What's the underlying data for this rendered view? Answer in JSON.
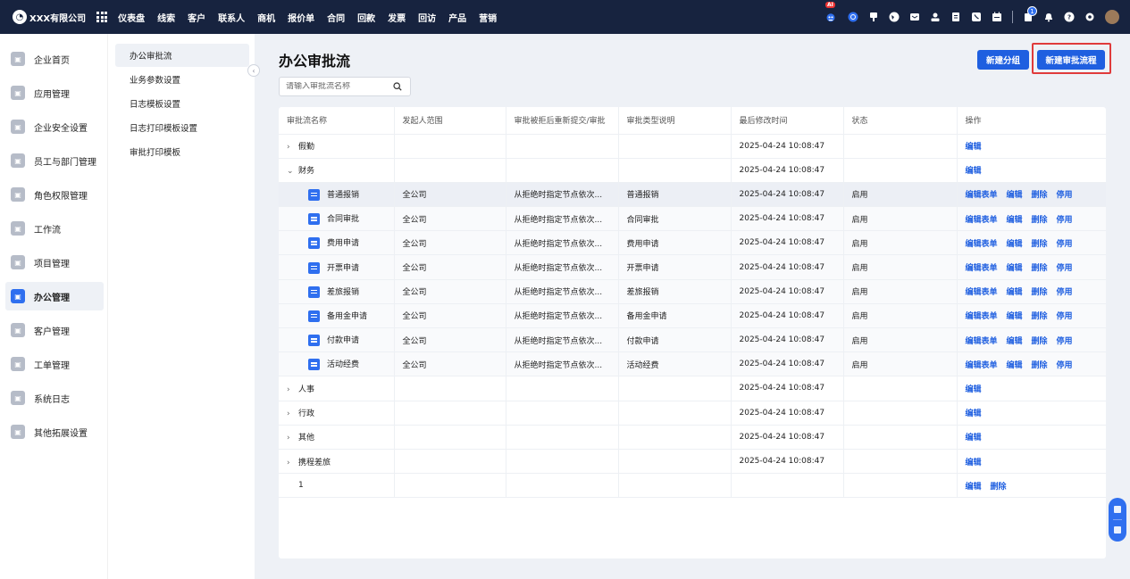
{
  "topbar": {
    "brand": "XXX有限公司",
    "nav": [
      "仪表盘",
      "线索",
      "客户",
      "联系人",
      "商机",
      "报价单",
      "合同",
      "回款",
      "发票",
      "回访",
      "产品",
      "营销"
    ],
    "ai_badge": "AI",
    "notification_count": "1",
    "icons": [
      "ai-robot-icon",
      "chat-icon",
      "pin-icon",
      "globe-icon",
      "mail-icon",
      "user-icon",
      "doc-icon",
      "phone-icon",
      "calendar-icon",
      "bell-icon",
      "help-icon",
      "settings-icon"
    ]
  },
  "sidebar": {
    "items": [
      {
        "label": "企业首页",
        "icon": "home-icon"
      },
      {
        "label": "应用管理",
        "icon": "apps-icon"
      },
      {
        "label": "企业安全设置",
        "icon": "shield-icon"
      },
      {
        "label": "员工与部门管理",
        "icon": "users-icon"
      },
      {
        "label": "角色权限管理",
        "icon": "role-icon"
      },
      {
        "label": "工作流",
        "icon": "workflow-icon"
      },
      {
        "label": "项目管理",
        "icon": "project-icon"
      },
      {
        "label": "办公管理",
        "icon": "office-icon",
        "active": true
      },
      {
        "label": "客户管理",
        "icon": "customer-icon"
      },
      {
        "label": "工单管理",
        "icon": "ticket-icon"
      },
      {
        "label": "系统日志",
        "icon": "log-icon"
      },
      {
        "label": "其他拓展设置",
        "icon": "extend-icon"
      }
    ]
  },
  "submenu": {
    "items": [
      "办公审批流",
      "业务参数设置",
      "日志模板设置",
      "日志打印模板设置",
      "审批打印模板"
    ],
    "active": 0
  },
  "main": {
    "title": "办公审批流",
    "search_placeholder": "请输入审批流名称",
    "btn_new_group": "新建分组",
    "btn_new_flow": "新建审批流程"
  },
  "table": {
    "headers": [
      "审批流名称",
      "发起人范围",
      "审批被拒后重新提交/审批",
      "审批类型说明",
      "最后修改时间",
      "状态",
      "操作"
    ],
    "rows": [
      {
        "name": "假勤",
        "type": "group",
        "expanded": false,
        "scope": "",
        "resubmit": "",
        "desc": "",
        "time": "2025-04-24 10:08:47",
        "status": "",
        "ops": [
          "编辑"
        ]
      },
      {
        "name": "财务",
        "type": "group",
        "expanded": true,
        "scope": "",
        "resubmit": "",
        "desc": "",
        "time": "2025-04-24 10:08:47",
        "status": "",
        "ops": [
          "编辑"
        ]
      },
      {
        "name": "普通报销",
        "type": "flow",
        "hl": true,
        "scope": "全公司",
        "resubmit": "从拒绝时指定节点依次...",
        "desc": "普通报销",
        "time": "2025-04-24 10:08:47",
        "status": "启用",
        "ops": [
          "编辑表单",
          "编辑",
          "删除",
          "停用"
        ]
      },
      {
        "name": "合同审批",
        "type": "flow",
        "scope": "全公司",
        "resubmit": "从拒绝时指定节点依次...",
        "desc": "合同审批",
        "time": "2025-04-24 10:08:47",
        "status": "启用",
        "ops": [
          "编辑表单",
          "编辑",
          "删除",
          "停用"
        ]
      },
      {
        "name": "费用申请",
        "type": "flow",
        "scope": "全公司",
        "resubmit": "从拒绝时指定节点依次...",
        "desc": "费用申请",
        "time": "2025-04-24 10:08:47",
        "status": "启用",
        "ops": [
          "编辑表单",
          "编辑",
          "删除",
          "停用"
        ]
      },
      {
        "name": "开票申请",
        "type": "flow",
        "scope": "全公司",
        "resubmit": "从拒绝时指定节点依次...",
        "desc": "开票申请",
        "time": "2025-04-24 10:08:47",
        "status": "启用",
        "ops": [
          "编辑表单",
          "编辑",
          "删除",
          "停用"
        ]
      },
      {
        "name": "差旅报销",
        "type": "flow",
        "scope": "全公司",
        "resubmit": "从拒绝时指定节点依次...",
        "desc": "差旅报销",
        "time": "2025-04-24 10:08:47",
        "status": "启用",
        "ops": [
          "编辑表单",
          "编辑",
          "删除",
          "停用"
        ]
      },
      {
        "name": "备用金申请",
        "type": "flow",
        "scope": "全公司",
        "resubmit": "从拒绝时指定节点依次...",
        "desc": "备用金申请",
        "time": "2025-04-24 10:08:47",
        "status": "启用",
        "ops": [
          "编辑表单",
          "编辑",
          "删除",
          "停用"
        ]
      },
      {
        "name": "付款申请",
        "type": "flow",
        "scope": "全公司",
        "resubmit": "从拒绝时指定节点依次...",
        "desc": "付款申请",
        "time": "2025-04-24 10:08:47",
        "status": "启用",
        "ops": [
          "编辑表单",
          "编辑",
          "删除",
          "停用"
        ]
      },
      {
        "name": "活动经费",
        "type": "flow",
        "scope": "全公司",
        "resubmit": "从拒绝时指定节点依次...",
        "desc": "活动经费",
        "time": "2025-04-24 10:08:47",
        "status": "启用",
        "ops": [
          "编辑表单",
          "编辑",
          "删除",
          "停用"
        ]
      },
      {
        "name": "人事",
        "type": "group",
        "expanded": false,
        "scope": "",
        "resubmit": "",
        "desc": "",
        "time": "2025-04-24 10:08:47",
        "status": "",
        "ops": [
          "编辑"
        ]
      },
      {
        "name": "行政",
        "type": "group",
        "expanded": false,
        "scope": "",
        "resubmit": "",
        "desc": "",
        "time": "2025-04-24 10:08:47",
        "status": "",
        "ops": [
          "编辑"
        ]
      },
      {
        "name": "其他",
        "type": "group",
        "expanded": false,
        "scope": "",
        "resubmit": "",
        "desc": "",
        "time": "2025-04-24 10:08:47",
        "status": "",
        "ops": [
          "编辑"
        ]
      },
      {
        "name": "携程差旅",
        "type": "group",
        "expanded": false,
        "scope": "",
        "resubmit": "",
        "desc": "",
        "time": "2025-04-24 10:08:47",
        "status": "",
        "ops": [
          "编辑"
        ]
      },
      {
        "name": "1",
        "type": "plain",
        "scope": "",
        "resubmit": "",
        "desc": "",
        "time": "",
        "status": "",
        "ops": [
          "编辑",
          "删除"
        ]
      }
    ]
  }
}
